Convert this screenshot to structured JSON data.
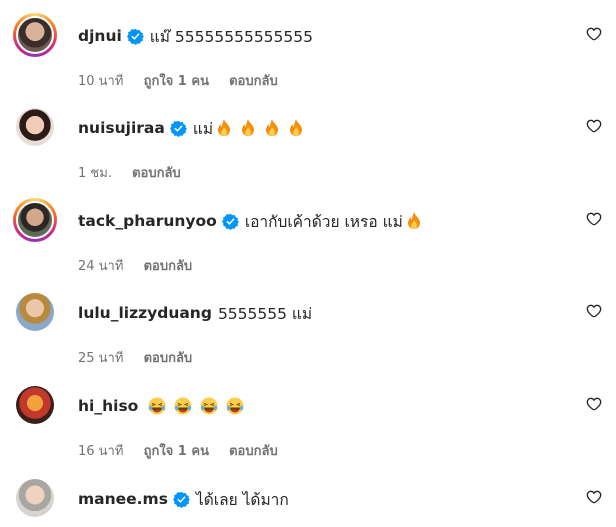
{
  "comments": [
    {
      "username": "djnui",
      "text": "แม๊ 55555555555555",
      "emojis": [],
      "time": "10 นาที",
      "likes": "ถูกใจ 1 คน",
      "reply": "ตอบกลับ"
    },
    {
      "username": "nuisujiraa",
      "text": "แม่",
      "emojis": [
        "fire",
        "fire",
        "fire",
        "fire"
      ],
      "time": "1 ชม.",
      "likes": "",
      "reply": "ตอบกลับ"
    },
    {
      "username": "tack_pharunyoo",
      "text": "เอากับเค้าด้วย เหรอ แม่",
      "emojis": [
        "fire"
      ],
      "time": "24 นาที",
      "likes": "",
      "reply": "ตอบกลับ"
    },
    {
      "username": "lulu_lizzyduang",
      "text": "5555555 แม่",
      "emojis": [],
      "time": "25 นาที",
      "likes": "",
      "reply": "ตอบกลับ"
    },
    {
      "username": "hi_hiso",
      "text": "",
      "emojis": [
        "laugh",
        "laugh",
        "laugh",
        "laugh"
      ],
      "time": "16 นาที",
      "likes": "ถูกใจ 1 คน",
      "reply": "ตอบกลับ"
    },
    {
      "username": "manee.ms",
      "text": "ได้เลย ได้มาก",
      "emojis": [],
      "time": "",
      "likes": "",
      "reply": ""
    }
  ],
  "colors": {
    "verified": "#0095f6",
    "meta_text": "#737373",
    "username": "#262626"
  },
  "icons": {
    "like": "heart-outline-icon",
    "verified": "verified-badge-icon"
  }
}
